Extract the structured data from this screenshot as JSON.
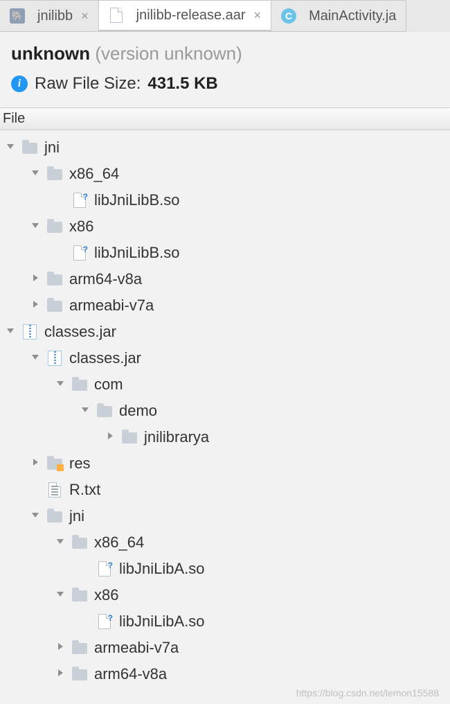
{
  "tabs": [
    {
      "label": "jnilibb",
      "kind": "gradle",
      "active": false,
      "closable": true
    },
    {
      "label": "jnilibb-release.aar",
      "kind": "doc",
      "active": true,
      "closable": true
    },
    {
      "label": "MainActivity.ja",
      "kind": "java",
      "active": false,
      "closable": false
    }
  ],
  "info": {
    "name": "unknown",
    "version_label": "version",
    "version_value": "unknown",
    "size_label": "Raw File Size:",
    "size_value": "431.5 KB"
  },
  "file_header": "File",
  "tree": [
    {
      "d": 0,
      "a": "open",
      "icon": "folder",
      "label": "jni"
    },
    {
      "d": 1,
      "a": "open",
      "icon": "folder",
      "label": "x86_64"
    },
    {
      "d": 2,
      "a": "blank",
      "icon": "docq",
      "label": "libJniLibB.so"
    },
    {
      "d": 1,
      "a": "open",
      "icon": "folder",
      "label": "x86"
    },
    {
      "d": 2,
      "a": "blank",
      "icon": "docq",
      "label": "libJniLibB.so"
    },
    {
      "d": 1,
      "a": "closed",
      "icon": "folder",
      "label": "arm64-v8a"
    },
    {
      "d": 1,
      "a": "closed",
      "icon": "folder",
      "label": "armeabi-v7a"
    },
    {
      "d": 0,
      "a": "open",
      "icon": "zip",
      "label": "classes.jar"
    },
    {
      "d": 1,
      "a": "open",
      "icon": "zip",
      "label": "classes.jar"
    },
    {
      "d": 2,
      "a": "open",
      "icon": "folder",
      "label": "com"
    },
    {
      "d": 3,
      "a": "open",
      "icon": "folder",
      "label": "demo"
    },
    {
      "d": 4,
      "a": "closed",
      "icon": "folder",
      "label": "jnilibrarya"
    },
    {
      "d": 1,
      "a": "closed",
      "icon": "folder-res",
      "label": "res"
    },
    {
      "d": 1,
      "a": "blank",
      "icon": "txt",
      "label": "R.txt"
    },
    {
      "d": 1,
      "a": "open",
      "icon": "folder",
      "label": "jni"
    },
    {
      "d": 2,
      "a": "open",
      "icon": "folder",
      "label": "x86_64"
    },
    {
      "d": 3,
      "a": "blank",
      "icon": "docq",
      "label": "libJniLibA.so"
    },
    {
      "d": 2,
      "a": "open",
      "icon": "folder",
      "label": "x86"
    },
    {
      "d": 3,
      "a": "blank",
      "icon": "docq",
      "label": "libJniLibA.so"
    },
    {
      "d": 2,
      "a": "closed",
      "icon": "folder",
      "label": "armeabi-v7a"
    },
    {
      "d": 2,
      "a": "closed",
      "icon": "folder",
      "label": "arm64-v8a"
    }
  ],
  "watermark": "https://blog.csdn.net/lemon15588"
}
